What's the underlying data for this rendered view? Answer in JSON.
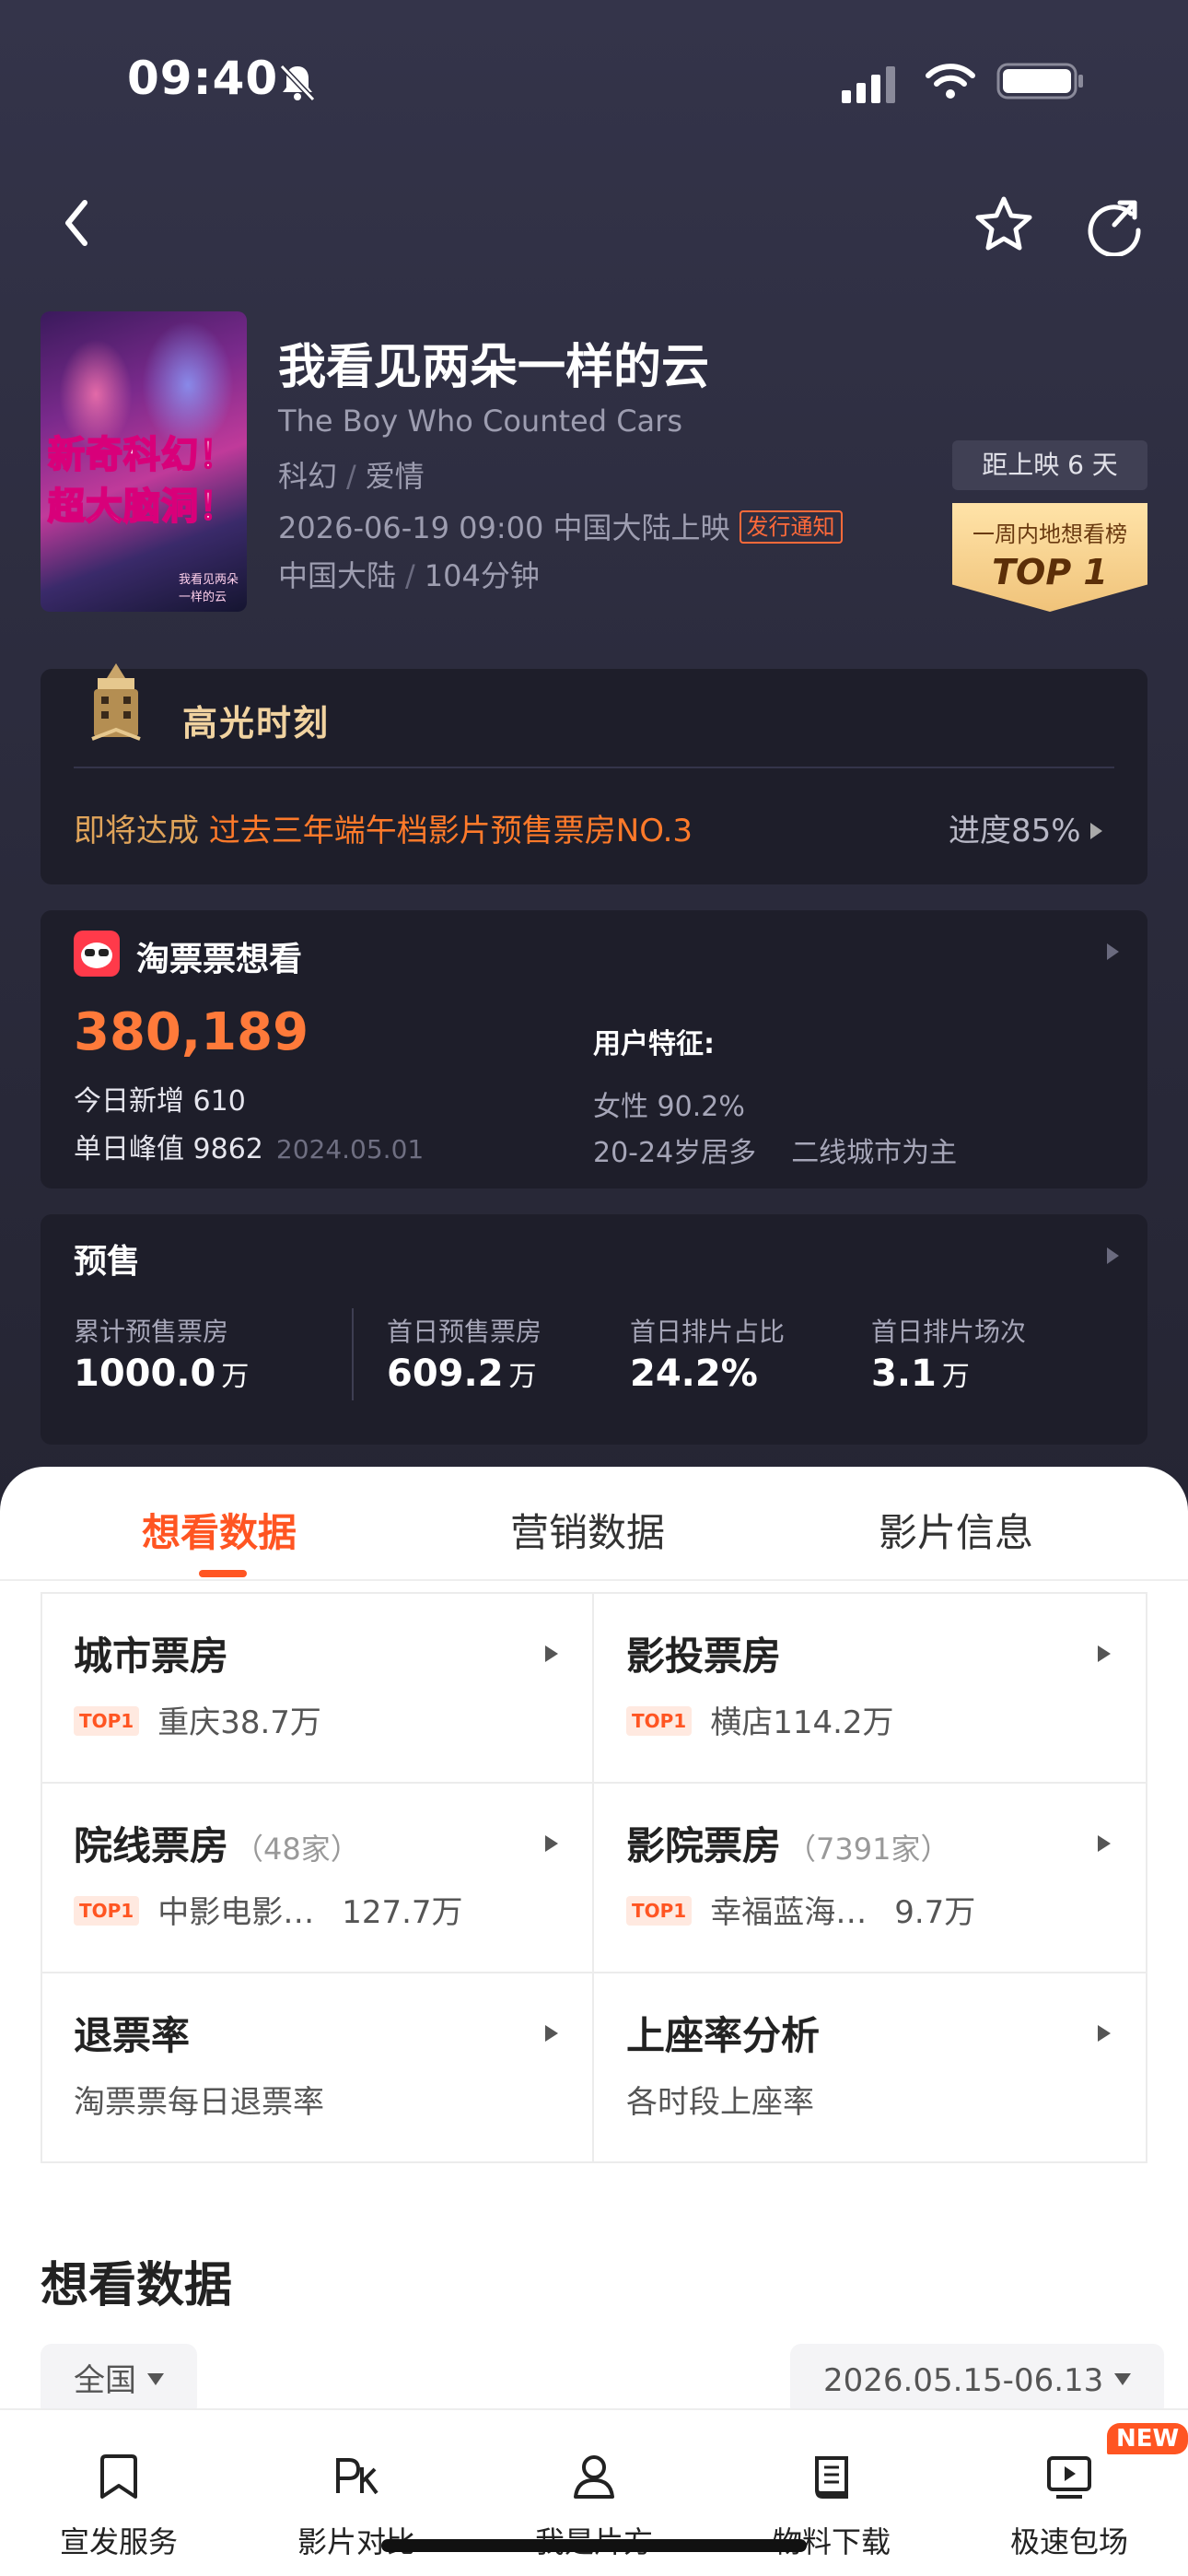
{
  "status_bar": {
    "time": "09:40"
  },
  "movie": {
    "poster_line1": "新奇科幻！",
    "poster_line2": "超大脑洞！",
    "poster_small": "我看见两朵一样的云",
    "title": "我看见两朵一样的云",
    "title_en": "The Boy Who Counted Cars",
    "genre1": "科幻",
    "genre2": "爱情",
    "release": "2026-06-19 09:00 中国大陆上映",
    "release_tag": "发行通知",
    "region": "中国大陆",
    "duration": "104分钟",
    "days_to_release": "距上映 6 天",
    "rank_label": "一周内地想看榜",
    "rank_value": "TOP 1"
  },
  "highlight": {
    "title": "高光时刻",
    "text_prefix": "即将达成 ",
    "text_highlight": "过去三年端午档影片预售票房NO.3",
    "progress": "进度85%"
  },
  "taopiao": {
    "title": "淘票票想看",
    "count": "380,189",
    "today_new": "今日新增 610",
    "peak": "单日峰值 9862",
    "peak_date": "2024.05.01",
    "feature_title": "用户特征:",
    "female": "女性 90.2%",
    "age": "20-24岁居多",
    "city": "二线城市为主"
  },
  "presale": {
    "title": "预售",
    "items": [
      {
        "label": "累计预售票房",
        "value": "1000.0",
        "unit": "万"
      },
      {
        "label": "首日预售票房",
        "value": "609.2",
        "unit": "万"
      },
      {
        "label": "首日排片占比",
        "value": "24.2%",
        "unit": ""
      },
      {
        "label": "首日排片场次",
        "value": "3.1",
        "unit": "万"
      }
    ]
  },
  "tabs": [
    "想看数据",
    "营销数据",
    "影片信息"
  ],
  "grid": {
    "city": {
      "title": "城市票房",
      "badge": "TOP1",
      "name": "重庆38.7万"
    },
    "investor": {
      "title": "影投票房",
      "badge": "TOP1",
      "name": "横店114.2万"
    },
    "chain": {
      "title": "院线票房",
      "count": "（48家）",
      "badge": "TOP1",
      "name": "中影电影…",
      "value": "127.7万"
    },
    "cinema": {
      "title": "影院票房",
      "count": "（7391家）",
      "badge": "TOP1",
      "name": "幸福蓝海…",
      "value": "9.7万"
    },
    "refund": {
      "title": "退票率",
      "sub": "淘票票每日退票率"
    },
    "occupancy": {
      "title": "上座率分析",
      "sub": "各时段上座率"
    }
  },
  "want_section": {
    "title": "想看数据",
    "region_filter": "全国",
    "date_filter": "2026.05.15-06.13"
  },
  "bottom_nav": {
    "items": [
      "宣发服务",
      "影片对比",
      "我是片方",
      "物料下载",
      "极速包场"
    ],
    "new_badge": "NEW"
  },
  "colors": {
    "accent": "#ff5522",
    "orange_num": "#ff7a3a",
    "gold": "#f1d3a0",
    "dark_bg": "#2c2c3e"
  }
}
